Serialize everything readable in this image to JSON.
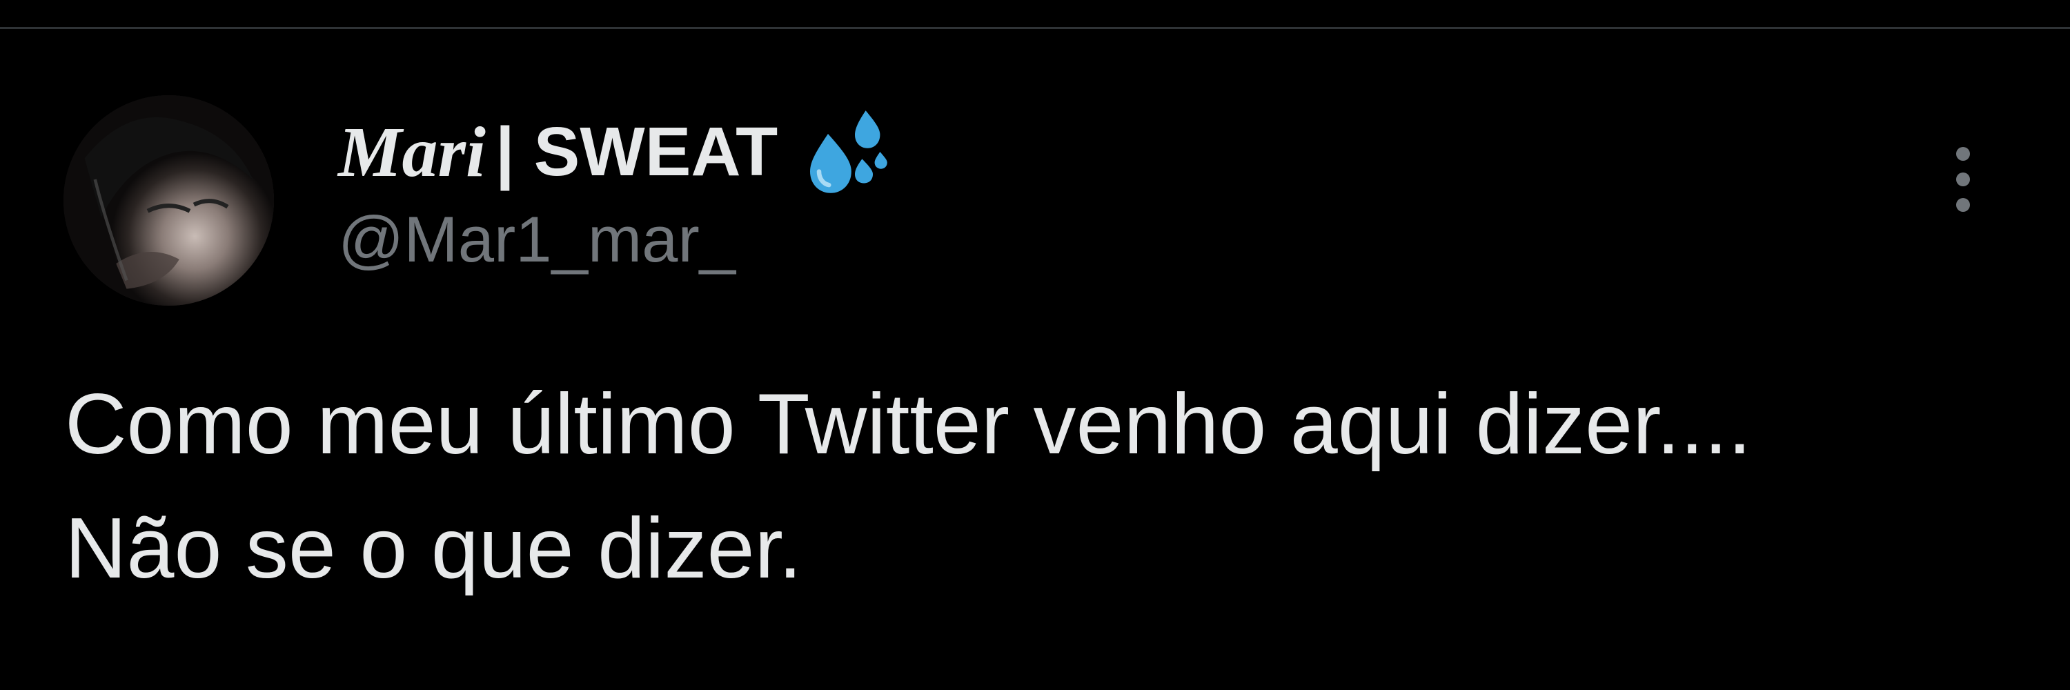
{
  "tweet": {
    "author": {
      "display_name_italic": "Mari",
      "display_name_rest": "| SWEAT",
      "emoji_icon": "sweat-droplets-icon",
      "handle": "@Mar1_mar_"
    },
    "more_icon": "more-vertical-icon",
    "text_line_1": "Como meu último Twitter venho aqui dizer....",
    "text_line_2": "Não se o que dizer."
  },
  "colors": {
    "background": "#000000",
    "primary_text": "#e7e9ea",
    "secondary_text": "#71767b",
    "divider": "#2f3336",
    "emoji_blue": "#3ea6e0"
  }
}
